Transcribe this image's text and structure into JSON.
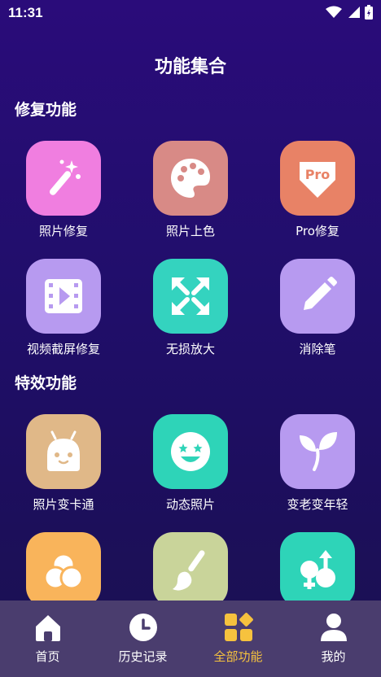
{
  "status_bar": {
    "time": "11:31"
  },
  "header": {
    "title": "功能集合"
  },
  "sections": [
    {
      "title": "修复功能",
      "items": [
        {
          "label": "照片修复",
          "icon": "magic-wand-icon",
          "color": "#f07ee0"
        },
        {
          "label": "照片上色",
          "icon": "palette-icon",
          "color": "#d88a86"
        },
        {
          "label": "Pro修复",
          "icon": "pro-badge-icon",
          "color": "#e88266",
          "badge_text": "Pro"
        },
        {
          "label": "视频截屏修复",
          "icon": "video-film-icon",
          "color": "#b79af0"
        },
        {
          "label": "无损放大",
          "icon": "expand-arrows-icon",
          "color": "#34d3bf"
        },
        {
          "label": "消除笔",
          "icon": "pencil-icon",
          "color": "#b79af0"
        }
      ]
    },
    {
      "title": "特效功能",
      "items": [
        {
          "label": "照片变卡通",
          "icon": "cartoon-face-icon",
          "color": "#e0b888"
        },
        {
          "label": "动态照片",
          "icon": "star-eyes-face-icon",
          "color": "#2ed4b8"
        },
        {
          "label": "变老变年轻",
          "icon": "sprout-icon",
          "color": "#b79af0"
        },
        {
          "label": "",
          "icon": "circles-icon",
          "color": "#f9b45b"
        },
        {
          "label": "",
          "icon": "paint-brush-icon",
          "color": "#c9d49a"
        },
        {
          "label": "",
          "icon": "gender-swap-icon",
          "color": "#2ed4b8"
        }
      ]
    }
  ],
  "tabbar": {
    "tabs": [
      {
        "label": "首页",
        "icon": "home-icon"
      },
      {
        "label": "历史记录",
        "icon": "clock-icon"
      },
      {
        "label": "全部功能",
        "icon": "grid-icon",
        "active": true
      },
      {
        "label": "我的",
        "icon": "person-icon"
      }
    ],
    "active_color": "#f6c23e"
  }
}
